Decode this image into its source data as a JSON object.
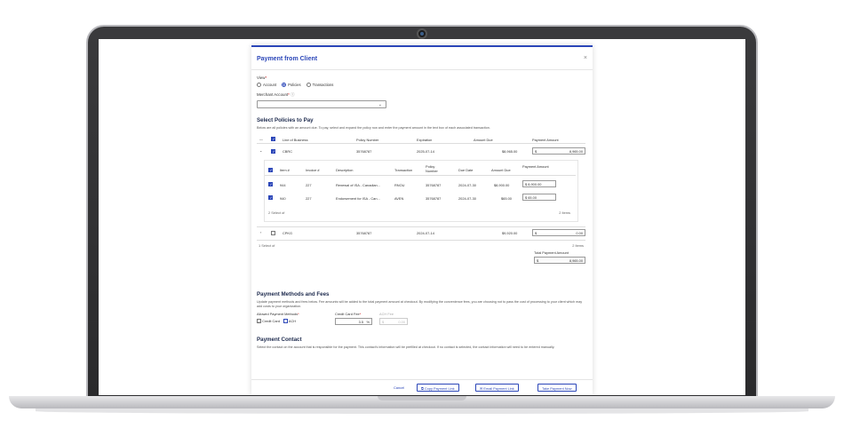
{
  "modal": {
    "title": "Payment from Client",
    "close": "×"
  },
  "view": {
    "label": "View",
    "options": [
      "Account",
      "Policies",
      "Transactions"
    ],
    "selected": "Policies"
  },
  "merchant": {
    "label": "Merchant Account",
    "value": ""
  },
  "policies": {
    "heading": "Select Policies to Pay",
    "desc": "Below are all policies with an amount due. To pay, select and expand the policy row and enter the payment amount in the text box of each associated transaction.",
    "columns": [
      "Line of Business",
      "Policy Number",
      "Expiration",
      "Amount Due",
      "Payment Amount"
    ],
    "rows": [
      {
        "lob": "CBRC",
        "policy": "35768787",
        "expiration": "2025-07-14",
        "amount_due": "$8,965.00",
        "currency": "$",
        "payment": "8,965.00",
        "checked": true,
        "expanded": true
      },
      {
        "lob": "CPKG",
        "policy": "35768787",
        "expiration": "2024-07-14",
        "amount_due": "$9,920.00",
        "currency": "$",
        "payment": "0.00",
        "checked": false,
        "expanded": false
      }
    ],
    "sub": {
      "columns": [
        "Item #",
        "Invoice #",
        "Description",
        "Transaction",
        "Policy Number",
        "Due Date",
        "Amount Due",
        "Payment Amount"
      ],
      "rows": [
        {
          "item": "944",
          "invoice": "227",
          "description": "Renewal of ISA - Canadian...",
          "transaction": "RNOU",
          "policy": "35768787",
          "due": "2024-07-30",
          "amount_due": "$8,900.00",
          "currency": "$",
          "payment": "8,900.00"
        },
        {
          "item": "940",
          "invoice": "227",
          "description": "Endorsement for ISA - Can...",
          "transaction": "AVEN",
          "policy": "35768787",
          "due": "2024-07-30",
          "amount_due": "$65.00",
          "currency": "$",
          "payment": "65.00"
        }
      ],
      "selected_text": "2 Select of",
      "items_text": "2 Items"
    },
    "selected_text": "1 Select of",
    "items_text": "2 Items",
    "total_label": "Total Payment Amount",
    "total_currency": "$",
    "total_value": "8,965.00"
  },
  "methods": {
    "heading": "Payment Methods and Fees",
    "desc": "Update payment methods and fees below. Fee amounts will be added to the total payment amount at checkout. By modifying the convenience fees, you are choosing not to pass the cost of processing to your client which may add costs to your organization.",
    "allowed_label": "Allowed Payment Methods",
    "credit_label": "Credit Card",
    "ach_label": "ACH",
    "cc_fee_label": "Credit Card Fee",
    "cc_fee_value": "3.5",
    "cc_fee_unit": "%",
    "ach_fee_label": "ACH Fee",
    "ach_fee_currency": "$",
    "ach_fee_value": "0.00"
  },
  "contact": {
    "heading": "Payment Contact",
    "desc": "Select the contact on the account that is responsible for the payment. This contact's information will be prefilled at checkout. If no contact is selected, the contact information will need to be entered manually."
  },
  "footer": {
    "cancel": "Cancel",
    "copy": "Copy Payment Link",
    "email": "Email Payment Link",
    "take": "Take Payment Now"
  }
}
